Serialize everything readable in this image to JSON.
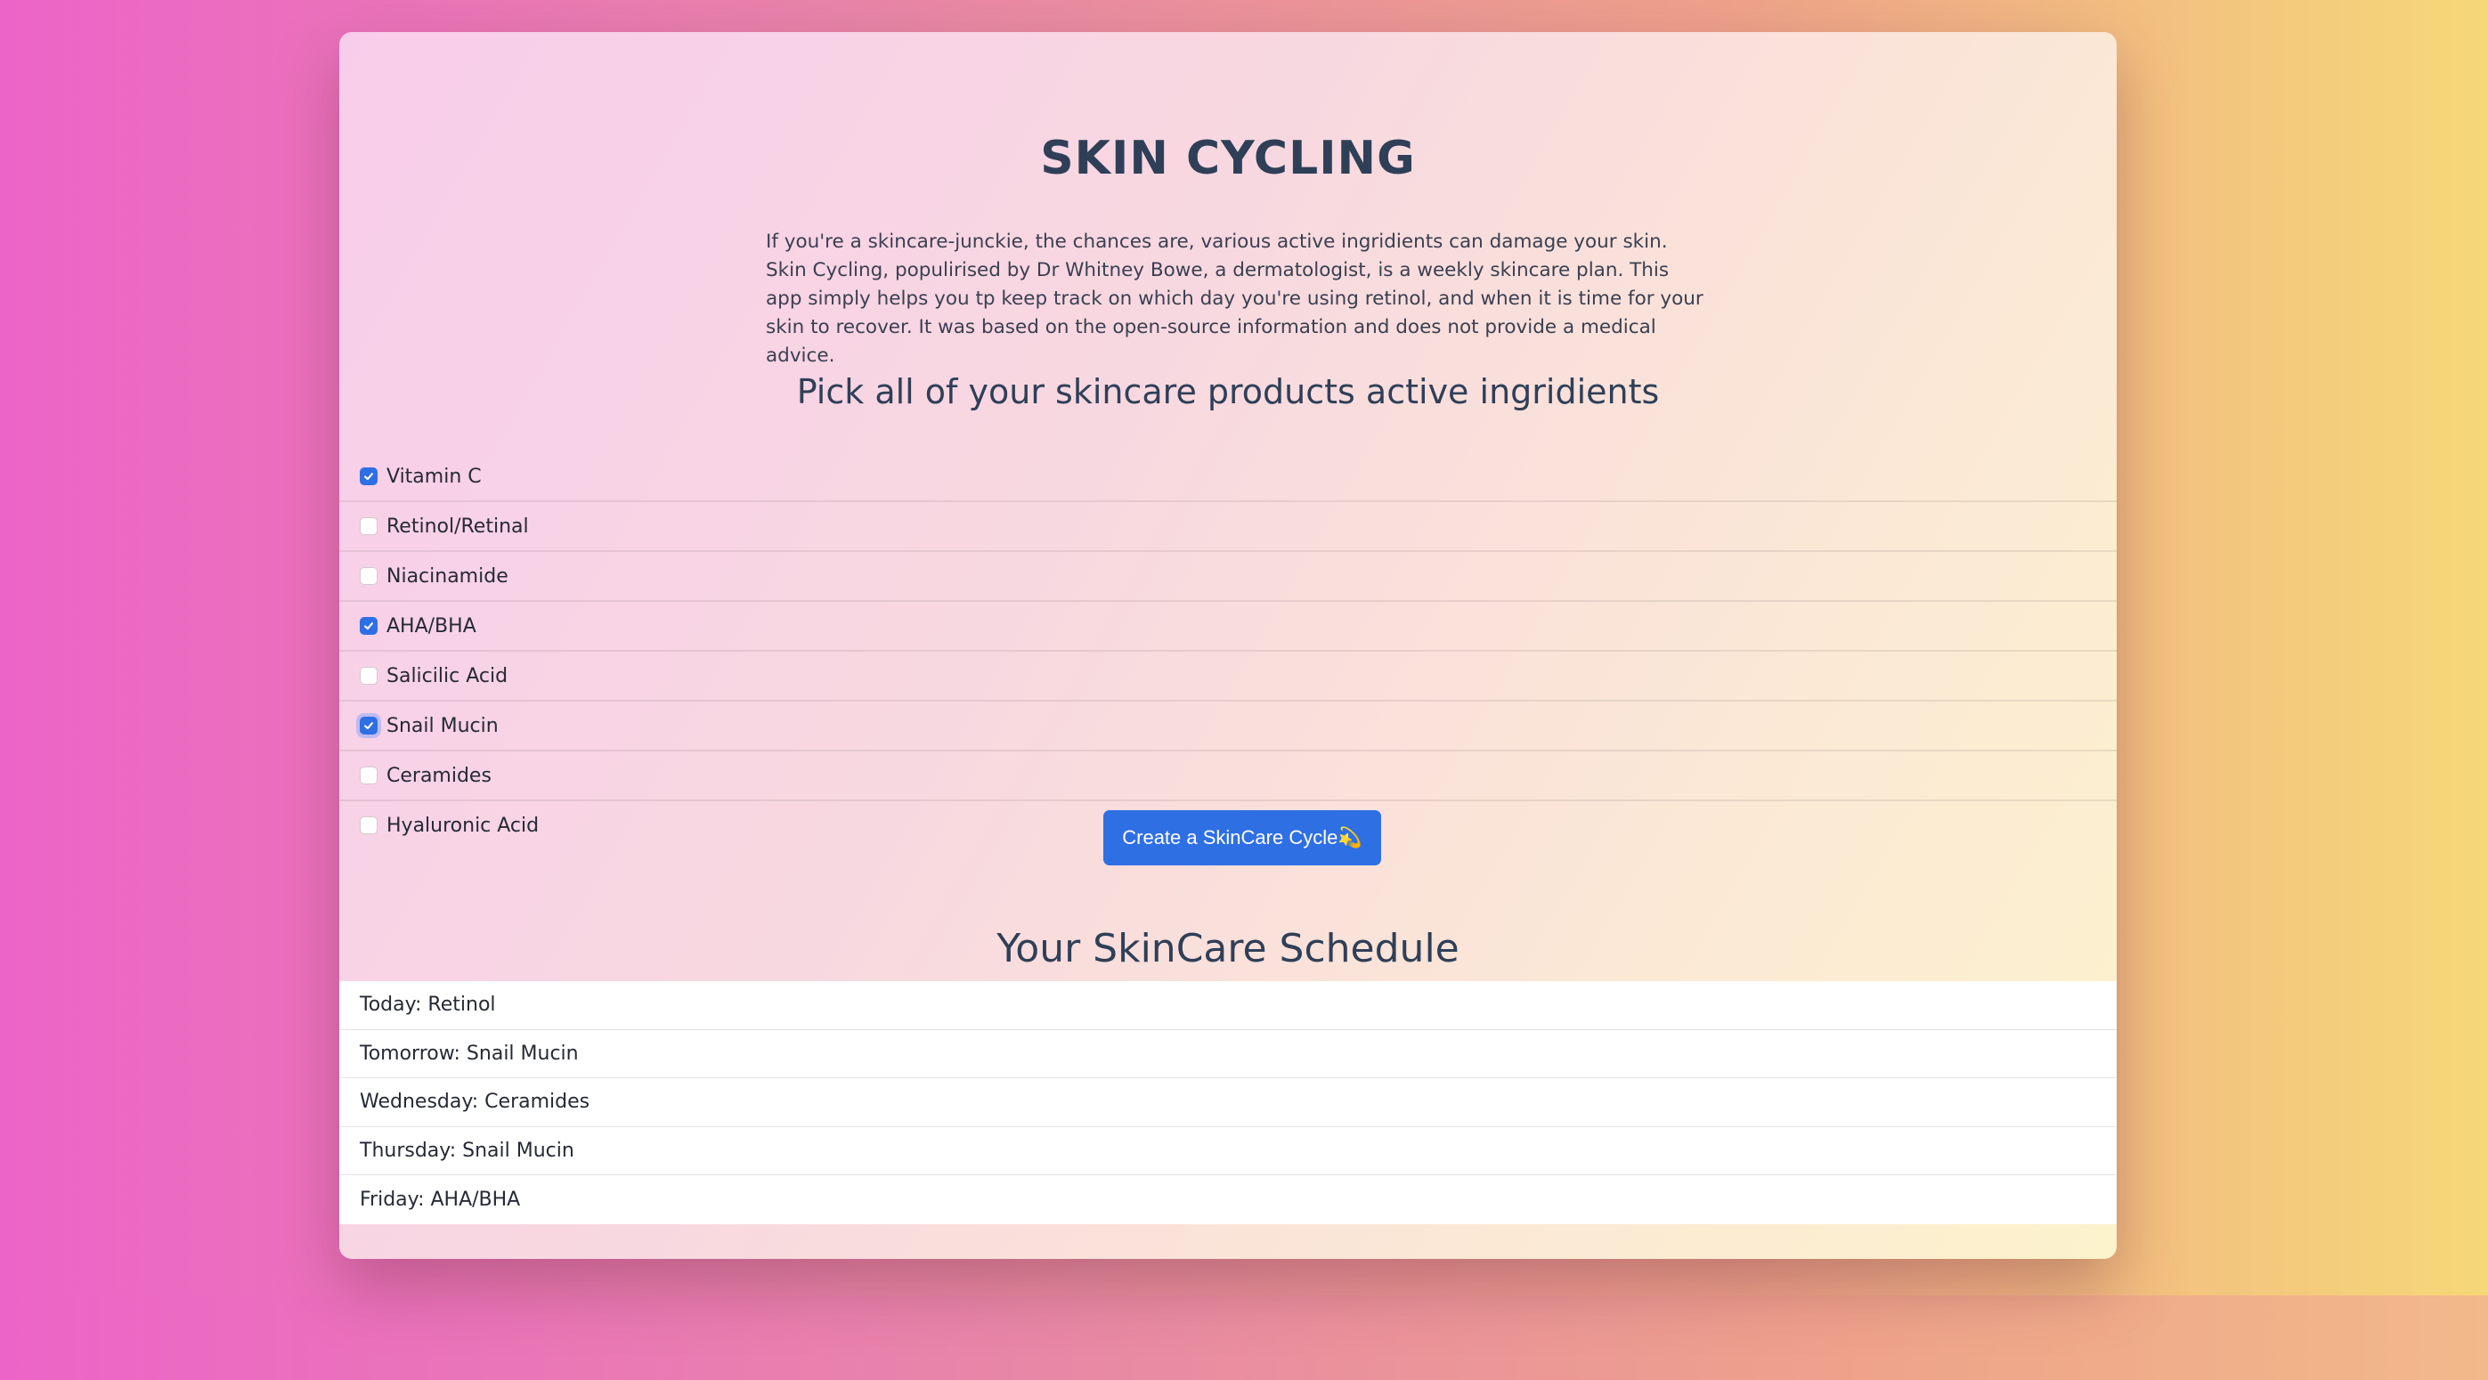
{
  "app": {
    "title": "SKIN CYCLING",
    "intro": "If you're a skincare-junckie, the chances are, various active ingridients can damage your skin. Skin Cycling, populirised by Dr Whitney Bowe, a dermatologist, is a weekly skincare plan. This app simply helps you tp keep track on which day you're using retinol, and when it is time for your skin to recover. It was based on the open-source information and does not provide a medical advice.",
    "pick_heading": "Pick all of your skincare products active ingridients"
  },
  "ingredients": [
    {
      "label": "Vitamin C",
      "checked": true
    },
    {
      "label": "Retinol/Retinal",
      "checked": false
    },
    {
      "label": "Niacinamide",
      "checked": false
    },
    {
      "label": "AHA/BHA",
      "checked": true
    },
    {
      "label": "Salicilic Acid",
      "checked": false
    },
    {
      "label": "Snail Mucin",
      "checked": true
    },
    {
      "label": "Ceramides",
      "checked": false
    },
    {
      "label": "Hyaluronic Acid",
      "checked": false
    }
  ],
  "cta": {
    "label": "Create a SkinCare Cycle💫"
  },
  "schedule": {
    "title": "Your SkinCare Schedule",
    "rows": [
      "Today: Retinol",
      "Tomorrow: Snail Mucin",
      "Wednesday: Ceramides",
      "Thursday: Snail Mucin",
      "Friday: AHA/BHA"
    ]
  },
  "colors": {
    "accent": "#2f6fe4",
    "heading": "#2f3f58"
  }
}
